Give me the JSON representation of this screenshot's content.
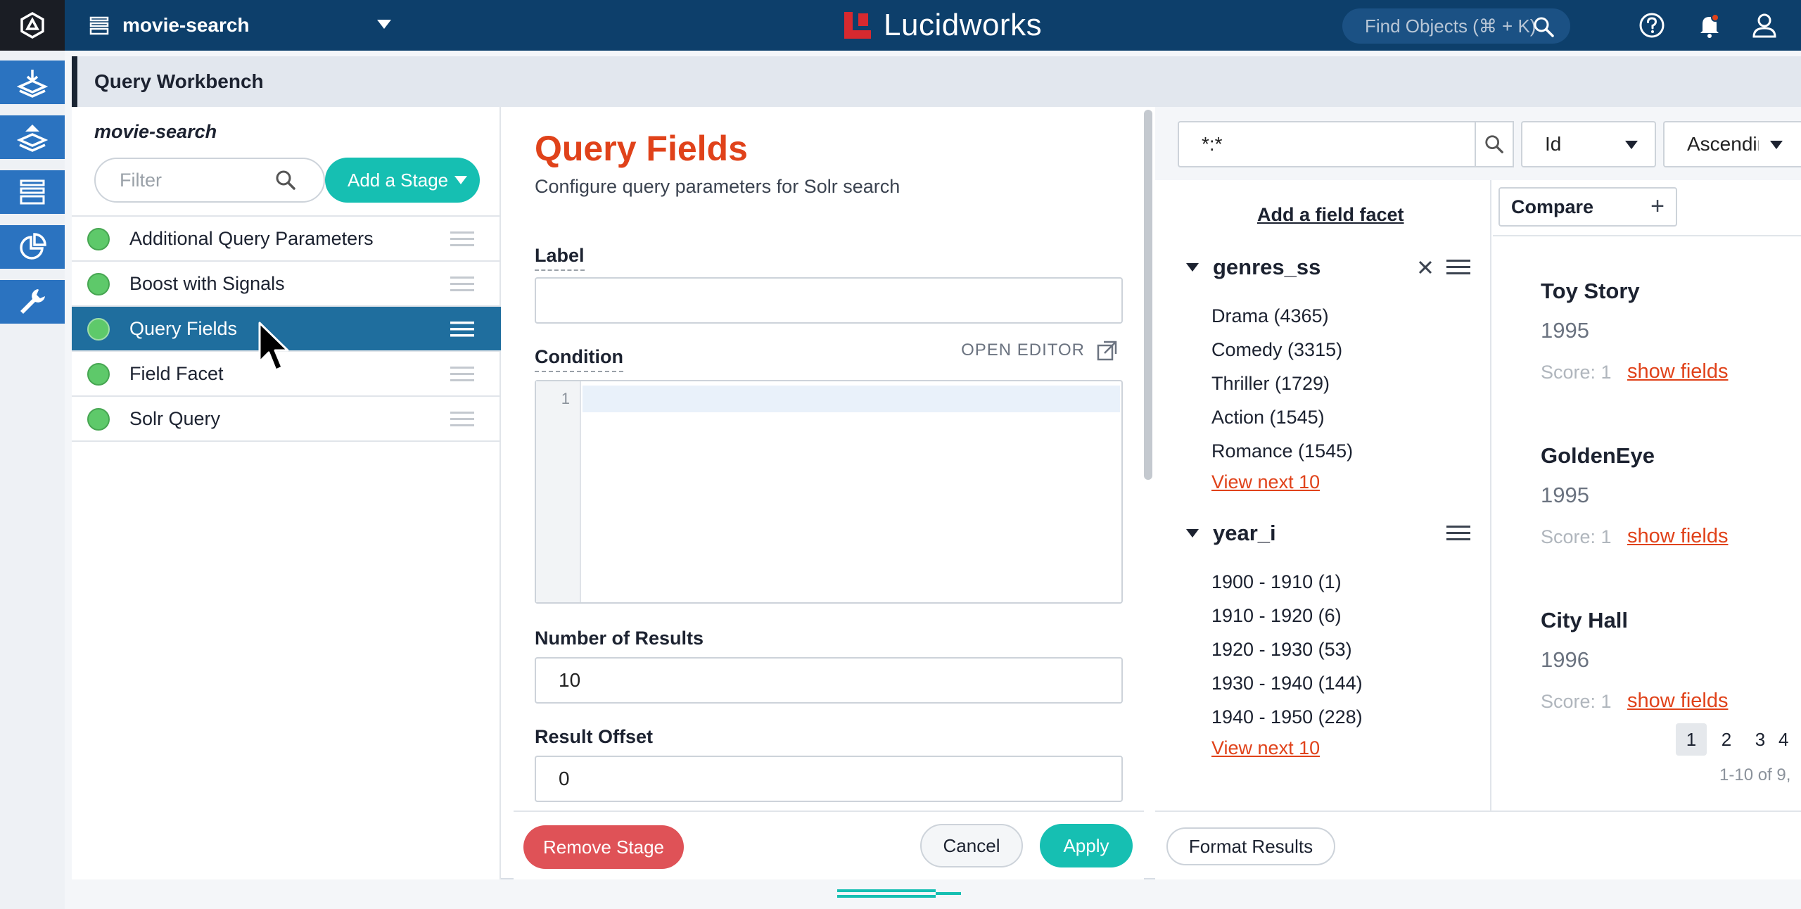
{
  "topbar": {
    "app_name": "movie-search",
    "brand": "Lucidworks",
    "find_placeholder": "Find Objects (⌘ + K)",
    "icons": [
      "fusion-logo-icon",
      "app-stack-icon",
      "chevron-down-icon",
      "lucidworks-logo-icon",
      "search-icon",
      "help-icon",
      "bell-icon",
      "user-icon"
    ]
  },
  "leftnav": {
    "items": [
      "collections-icon",
      "indexing-icon",
      "querying-icon",
      "analytics-icon",
      "system-tools-icon"
    ]
  },
  "workbench": {
    "title": "Query Workbench"
  },
  "pipeline": {
    "name": "movie-search",
    "filter_placeholder": "Filter",
    "add_stage_label": "Add a Stage",
    "stages": [
      {
        "label": "Additional Query Parameters",
        "active": false
      },
      {
        "label": "Boost with Signals",
        "active": false
      },
      {
        "label": "Query Fields",
        "active": true
      },
      {
        "label": "Field Facet",
        "active": false
      },
      {
        "label": "Solr Query",
        "active": false
      }
    ]
  },
  "editor": {
    "title": "Query Fields",
    "subtitle": "Configure query parameters for Solr search",
    "label_field": {
      "label": "Label",
      "value": ""
    },
    "condition": {
      "label": "Condition",
      "open_editor": "OPEN EDITOR",
      "line_number": "1"
    },
    "num_results": {
      "label": "Number of Results",
      "value": "10"
    },
    "result_offset": {
      "label": "Result Offset",
      "value": "0"
    },
    "remove_label": "Remove Stage",
    "cancel_label": "Cancel",
    "apply_label": "Apply"
  },
  "results": {
    "query": "*:*",
    "sort_field": "Id",
    "sort_order": "Ascending",
    "add_facet_label": "Add a field facet",
    "facets": [
      {
        "name": "genres_ss",
        "items": [
          "Drama (4365)",
          "Comedy (3315)",
          "Thriller (1729)",
          "Action (1545)",
          "Romance (1545)"
        ],
        "view_next": "View next 10"
      },
      {
        "name": "year_i",
        "items": [
          "1900 - 1910 (1)",
          "1910 - 1920 (6)",
          "1920 - 1930 (53)",
          "1930 - 1940 (144)",
          "1940 - 1950 (228)"
        ],
        "view_next": "View next 10"
      }
    ],
    "compare_label": "Compare",
    "docs": [
      {
        "title": "Toy Story",
        "year": "1995",
        "score": "Score: 1",
        "show_fields": "show fields"
      },
      {
        "title": "GoldenEye",
        "year": "1995",
        "score": "Score: 1",
        "show_fields": "show fields"
      },
      {
        "title": "City Hall",
        "year": "1996",
        "score": "Score: 1",
        "show_fields": "show fields"
      }
    ],
    "pages": [
      "1",
      "2",
      "3",
      "4"
    ],
    "range": "1-10 of 9,",
    "format_label": "Format Results"
  },
  "colors": {
    "topbar": "#0d3f6b",
    "nav_accent": "#2b73c0",
    "teal": "#16bfb2",
    "orange": "#e0421a",
    "danger": "#df5257",
    "active_stage": "#1f6e9e"
  }
}
